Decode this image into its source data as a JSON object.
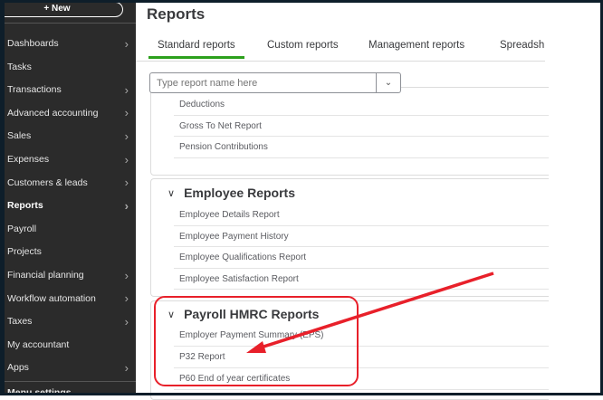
{
  "sidebar": {
    "new_label": "+ New",
    "items": [
      {
        "label": "Dashboards",
        "chevron": true
      },
      {
        "label": "Tasks",
        "chevron": false
      },
      {
        "label": "Transactions",
        "chevron": true
      },
      {
        "label": "Advanced accounting",
        "chevron": true
      },
      {
        "label": "Sales",
        "chevron": true
      },
      {
        "label": "Expenses",
        "chevron": true
      },
      {
        "label": "Customers & leads",
        "chevron": true
      },
      {
        "label": "Reports",
        "chevron": true,
        "active": true
      },
      {
        "label": "Payroll",
        "chevron": false
      },
      {
        "label": "Projects",
        "chevron": false
      },
      {
        "label": "Financial planning",
        "chevron": true
      },
      {
        "label": "Workflow automation",
        "chevron": true
      },
      {
        "label": "Taxes",
        "chevron": true
      },
      {
        "label": "My accountant",
        "chevron": false
      },
      {
        "label": "Apps",
        "chevron": true
      }
    ],
    "menu_settings": "Menu settings"
  },
  "main": {
    "title": "Reports",
    "tabs": [
      "Standard reports",
      "Custom reports",
      "Management reports",
      "Spreadsh"
    ],
    "search": {
      "placeholder": "Type report name here"
    },
    "sections": [
      {
        "title": "",
        "items": [
          "Deductions",
          "Gross To Net Report",
          "Pension Contributions"
        ]
      },
      {
        "title": "Employee Reports",
        "items": [
          "Employee Details Report",
          "Employee Payment History",
          "Employee Qualifications Report",
          "Employee Satisfaction Report"
        ]
      },
      {
        "title": "Payroll HMRC Reports",
        "items": [
          "Employer Payment Summary (EPS)",
          "P32 Report",
          "P60 End of year certificates"
        ]
      }
    ]
  },
  "annotation": {
    "color": "#e8202a"
  }
}
